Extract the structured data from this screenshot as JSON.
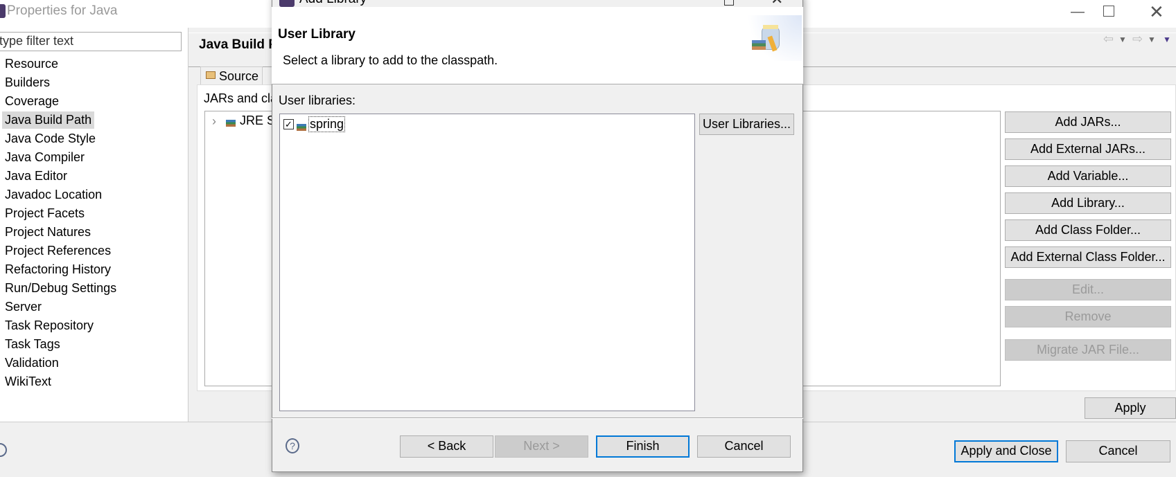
{
  "window": {
    "title": "Properties for Java",
    "minimize_icon": "minimize-icon",
    "maximize_icon": "maximize-icon",
    "close_icon": "close-icon"
  },
  "sidebar": {
    "filter_value": "type filter text",
    "items": [
      {
        "label": "Resource"
      },
      {
        "label": "Builders"
      },
      {
        "label": "Coverage"
      },
      {
        "label": "Java Build Path",
        "selected": true
      },
      {
        "label": "Java Code Style"
      },
      {
        "label": "Java Compiler"
      },
      {
        "label": "Java Editor"
      },
      {
        "label": "Javadoc Location"
      },
      {
        "label": "Project Facets"
      },
      {
        "label": "Project Natures"
      },
      {
        "label": "Project References"
      },
      {
        "label": "Refactoring History"
      },
      {
        "label": "Run/Debug Settings"
      },
      {
        "label": "Server"
      },
      {
        "label": "Task Repository"
      },
      {
        "label": "Task Tags"
      },
      {
        "label": "Validation"
      },
      {
        "label": "WikiText"
      }
    ]
  },
  "page": {
    "title": "Java Build Path",
    "tab_source": "Source",
    "jars_label": "JARs and class folders on the build path:",
    "tree_item": "JRE System Library",
    "buttons": {
      "add_jars": "Add JARs...",
      "add_external_jars": "Add External JARs...",
      "add_variable": "Add Variable...",
      "add_library": "Add Library...",
      "add_class_folder": "Add Class Folder...",
      "add_external_class_folder": "Add External Class Folder...",
      "edit": "Edit...",
      "remove": "Remove",
      "migrate": "Migrate JAR File..."
    },
    "apply": "Apply"
  },
  "footer": {
    "apply_close": "Apply and Close",
    "cancel": "Cancel"
  },
  "dialog": {
    "title": "Add Library",
    "heading": "User Library",
    "subtitle": "Select a library to add to the classpath.",
    "list_label": "User libraries:",
    "libraries": [
      {
        "name": "spring",
        "checked": true
      }
    ],
    "user_libraries_button": "User Libraries...",
    "back": "< Back",
    "next": "Next >",
    "finish": "Finish",
    "cancel": "Cancel"
  },
  "colors": {
    "accent": "#0078d7",
    "selection": "#d9d9d9"
  }
}
